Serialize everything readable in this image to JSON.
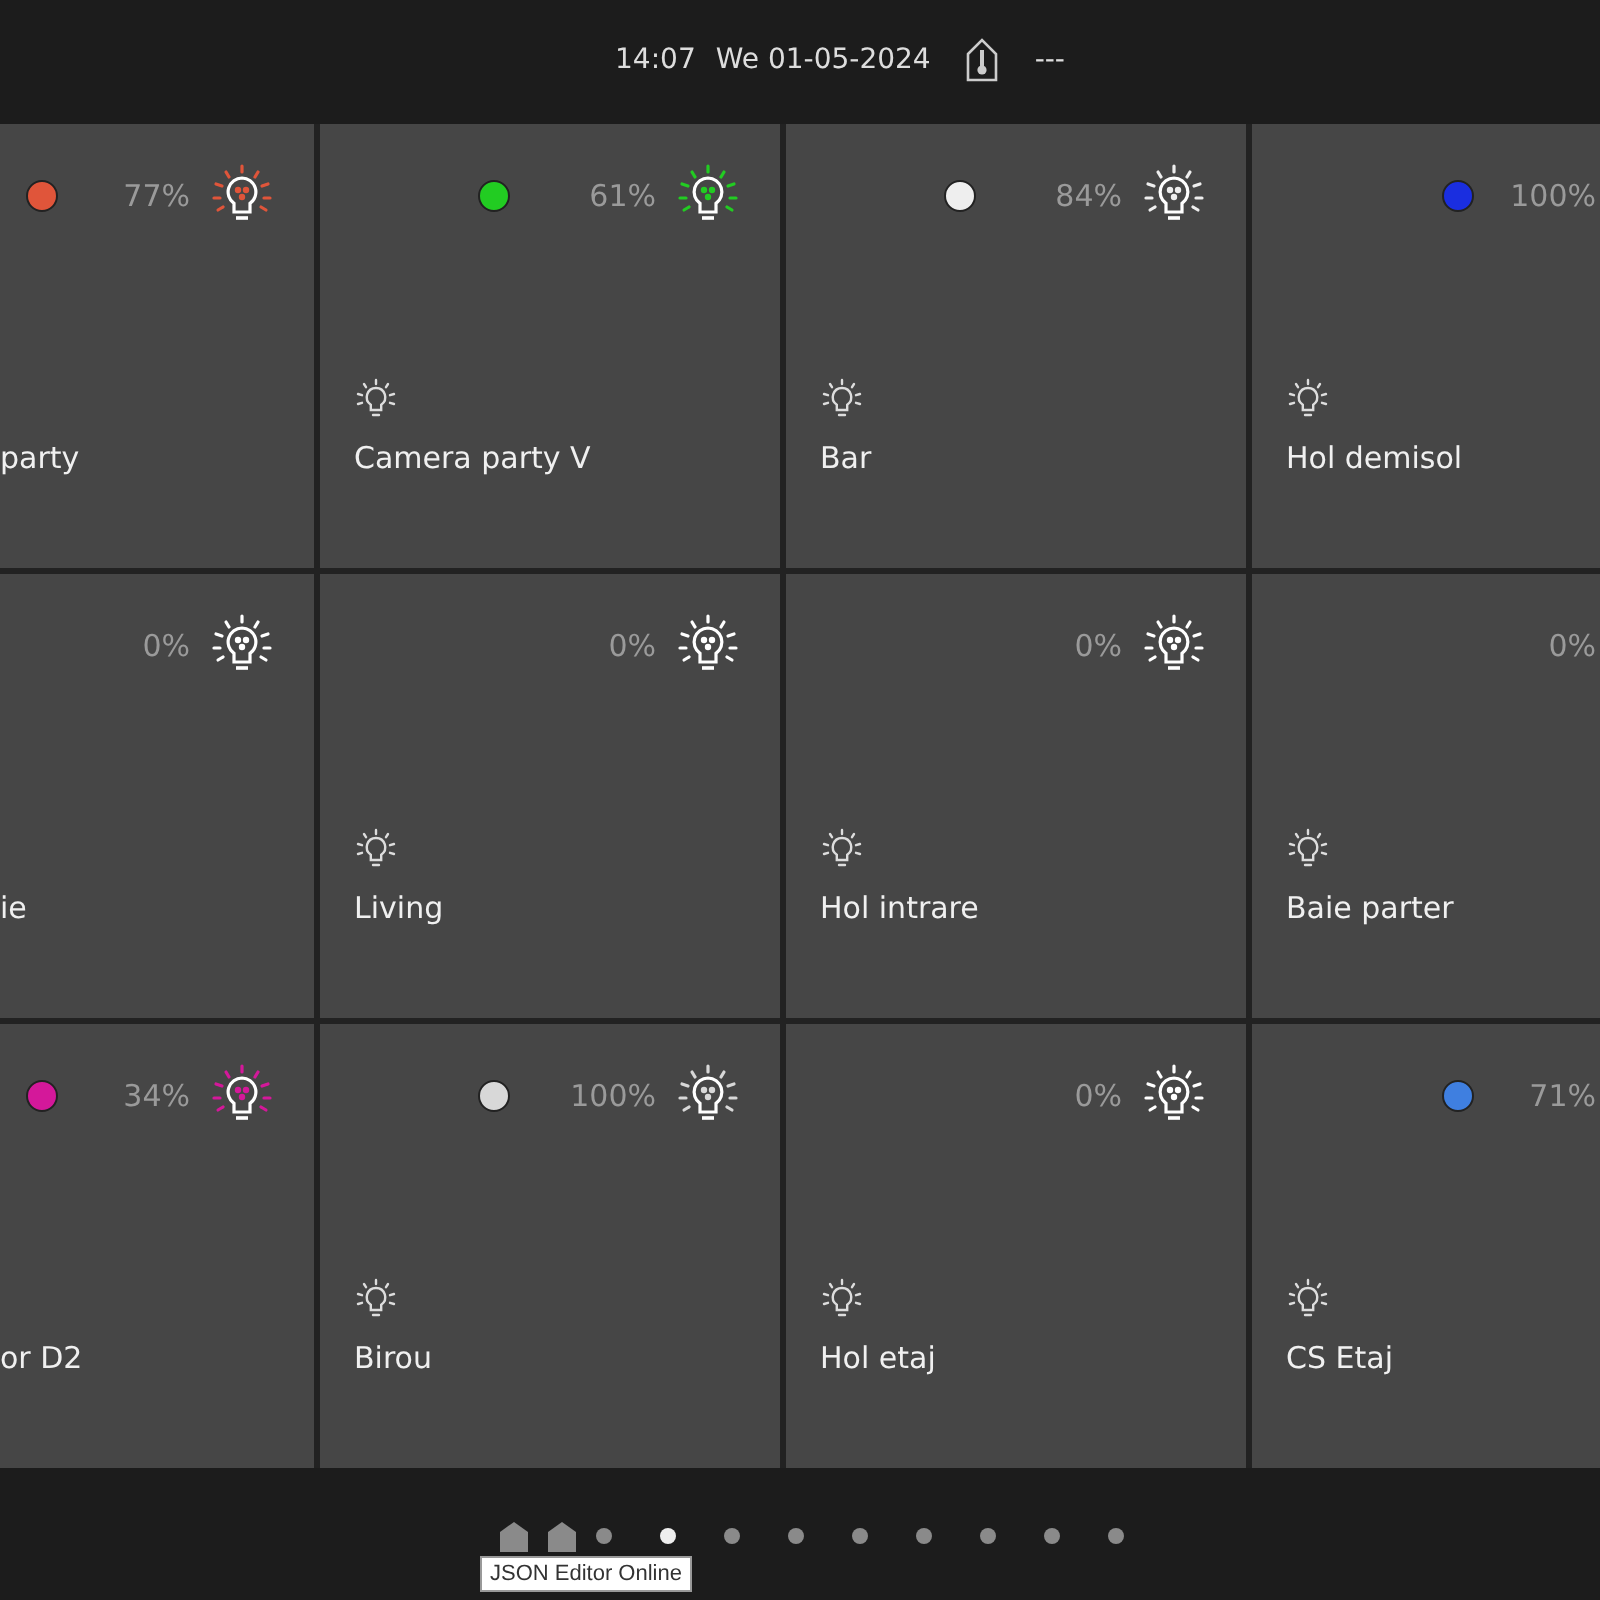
{
  "header": {
    "time": "14:07",
    "date": "We 01-05-2024",
    "temperature": "---"
  },
  "tiles": [
    {
      "kind": "cut_left",
      "name": "party",
      "reading": "77%",
      "color": "#e0553a"
    },
    {
      "kind": "full",
      "name": "Camera party V",
      "reading": "61%",
      "color": "#22cc22"
    },
    {
      "kind": "full",
      "name": "Bar",
      "reading": "84%",
      "color": "#eeeeee"
    },
    {
      "kind": "cut_right",
      "name": "Hol demisol",
      "reading": "100%",
      "color": "#1a2ee0"
    },
    {
      "kind": "cut_left",
      "name": "ie",
      "reading": "0%"
    },
    {
      "kind": "full",
      "name": "Living",
      "reading": "0%"
    },
    {
      "kind": "full",
      "name": "Hol intrare",
      "reading": "0%"
    },
    {
      "kind": "cut_right",
      "name": "Baie parter",
      "reading": "0%"
    },
    {
      "kind": "cut_left",
      "name": "or D2",
      "reading": "34%",
      "color": "#d4189a"
    },
    {
      "kind": "full",
      "name": "Birou",
      "reading": "100%",
      "color": "#d8d8d8"
    },
    {
      "kind": "full",
      "name": "Hol etaj",
      "reading": "0%"
    },
    {
      "kind": "cut_right",
      "name": "CS Etaj",
      "reading": "71%",
      "color": "#3f7fe0"
    }
  ],
  "pages": [
    {
      "kind": "home",
      "selected": false
    },
    {
      "kind": "home",
      "selected": false
    },
    {
      "kind": "dot",
      "selected": false
    },
    {
      "kind": "dot",
      "selected": true
    },
    {
      "kind": "dot",
      "selected": false
    },
    {
      "kind": "dot",
      "selected": false
    },
    {
      "kind": "dot",
      "selected": false
    },
    {
      "kind": "dot",
      "selected": false
    },
    {
      "kind": "dot",
      "selected": false
    },
    {
      "kind": "dot",
      "selected": false
    },
    {
      "kind": "dot",
      "selected": false
    }
  ],
  "tooltip": "JSON Editor Online"
}
